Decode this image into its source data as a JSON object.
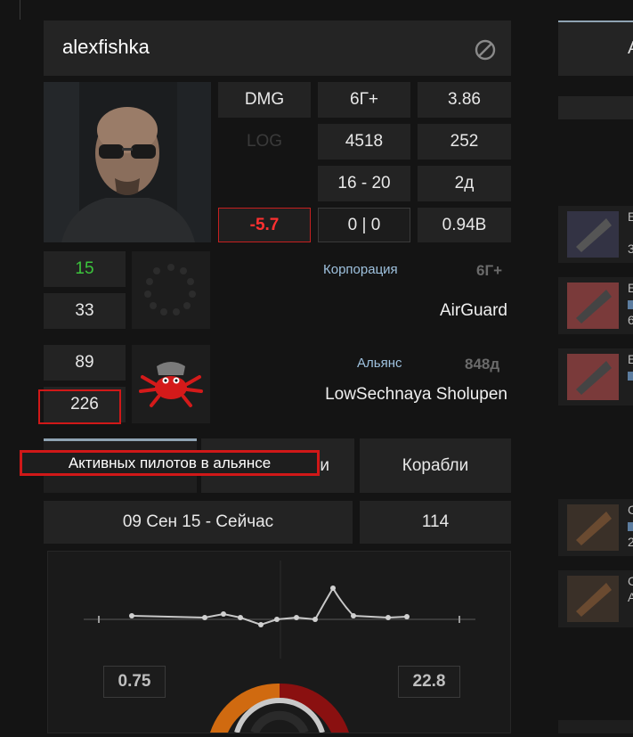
{
  "header": {
    "pilot_name": "alexfishka",
    "ban_icon": "ban-icon"
  },
  "stats": {
    "dmg_label": "DMG",
    "dmg_value": "6Г+",
    "dmg_ratio": "3.86",
    "log_label": "LOG",
    "log_value": "4518",
    "log_count": "252",
    "range": "16 - 20",
    "duration": "2д",
    "delta": "-5.7",
    "kills_losses": "0  |  0",
    "isk": "0.94B"
  },
  "left_counts": {
    "top": "15",
    "mid": "33",
    "alliance_a": "89",
    "alliance_b": "226"
  },
  "corporation": {
    "label": "Корпорация",
    "age": "6Г+",
    "name": "AirGuard"
  },
  "alliance": {
    "label": "Альянс",
    "age": "848д",
    "name": "LowSechnaya Sholupen"
  },
  "tabs": {
    "tab_2_partial": "и",
    "tab_3": "Корабли"
  },
  "tooltip": "Активных пилотов в альянсе",
  "period": {
    "range": "09 Сен 15 - Сейчас",
    "count": "114"
  },
  "graph": {
    "left_value": "0.75",
    "right_value": "22.8"
  },
  "right_panel": {
    "header_partial": "А",
    "items": [
      {
        "letter": "Е",
        "sub": "3"
      },
      {
        "letter": "Е",
        "sub": "6"
      },
      {
        "letter": "Е",
        "sub": ""
      },
      {
        "letter": "С",
        "sub": "2"
      },
      {
        "letter": "С",
        "sub": "А"
      }
    ]
  },
  "colors": {
    "accent_red": "#d01818",
    "positive_green": "#3cc43c",
    "tab_accent": "#8fa3b3",
    "donut_orange": "#d06a10",
    "donut_red": "#8a1010"
  }
}
